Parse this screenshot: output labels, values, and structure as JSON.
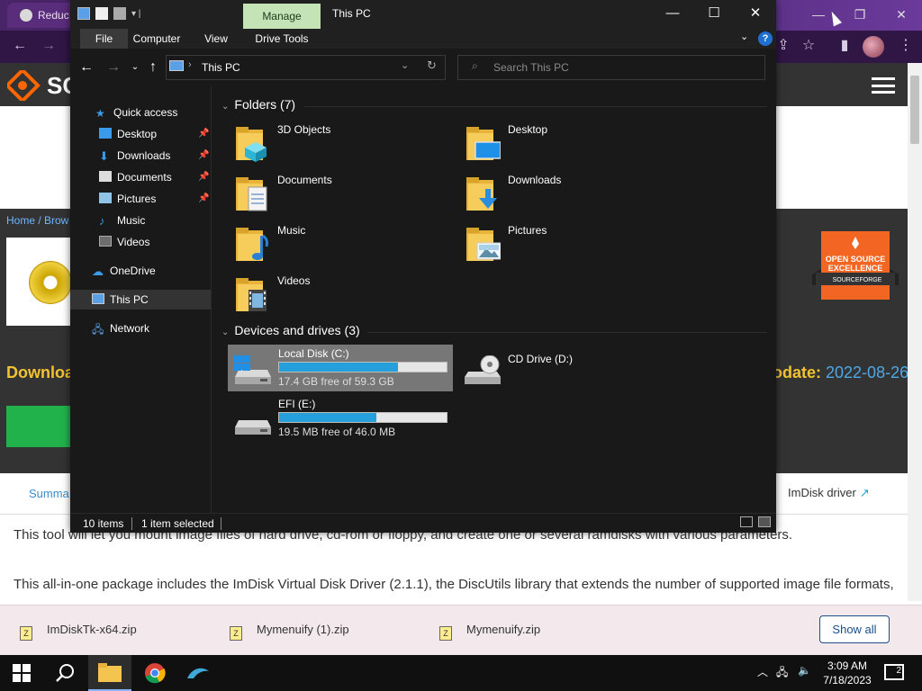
{
  "browser": {
    "tab_title": "Reduc",
    "site_logo_text": "SC",
    "breadcrumb": "Home / Brow",
    "download_partial": "Downloa",
    "update_label": "odate:",
    "update_date": "2022-08-26",
    "badge": {
      "line1": "OPEN SOURCE",
      "line2": "EXCELLENCE",
      "line3": "SOURCEFORGE"
    },
    "tab_summary": "Summa",
    "imdisk_link": "ImDisk driver",
    "desc1": "This tool will let you mount image files of hard drive, cd-rom or floppy, and create one or several ramdisks with various parameters.",
    "desc2": "This all-in-one package includes the ImDisk Virtual Disk Driver (2.1.1), the DiscUtils library that extends the number of supported image file formats, and adds several GUIs and features.",
    "downloads": [
      {
        "name": "ImDiskTk-x64.zip"
      },
      {
        "name": "Mymenuify (1).zip"
      },
      {
        "name": "Mymenuify.zip"
      }
    ],
    "show_all": "Show all"
  },
  "taskbar": {
    "time": "3:09 AM",
    "date": "7/18/2023",
    "notifications": "2"
  },
  "explorer": {
    "manage_label": "Manage",
    "title": "This PC",
    "ribbon_tabs": [
      "File",
      "Computer",
      "View",
      "Drive Tools"
    ],
    "address": "This PC",
    "search_placeholder": "Search This PC",
    "nav": {
      "quick_access": "Quick access",
      "quick_items": [
        "Desktop",
        "Downloads",
        "Documents",
        "Pictures",
        "Music",
        "Videos"
      ],
      "onedrive": "OneDrive",
      "this_pc": "This PC",
      "network": "Network"
    },
    "folders_title": "Folders (7)",
    "folders": [
      {
        "name": "3D Objects"
      },
      {
        "name": "Desktop"
      },
      {
        "name": "Documents"
      },
      {
        "name": "Downloads"
      },
      {
        "name": "Music"
      },
      {
        "name": "Pictures"
      },
      {
        "name": "Videos"
      }
    ],
    "drives_title": "Devices and drives (3)",
    "drives": [
      {
        "name": "Local Disk (C:)",
        "free": "17.4 GB free of 59.3 GB",
        "used_fraction": 0.71
      },
      {
        "name": "CD Drive (D:)"
      },
      {
        "name": "EFI (E:)",
        "free": "19.5 MB free of 46.0 MB",
        "used_fraction": 0.58
      }
    ],
    "status_items": "10 items",
    "status_selected": "1 item selected"
  },
  "colors": {
    "explorer_bg": "#191919",
    "manage_tab": "#c4e4b8",
    "drive_fill": "#26a0da",
    "selected_drive": "#777777",
    "browser_tab": "#5a2c7c"
  }
}
